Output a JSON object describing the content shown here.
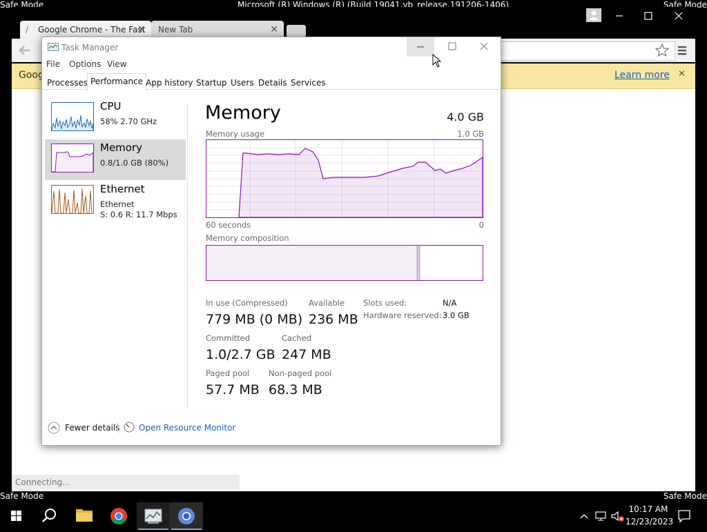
{
  "desktop": {
    "safe_mode": "Safe Mode",
    "build_text": "Microsoft (R) Windows (R) (Build 19041.vb_release.191206-1406)"
  },
  "chrome": {
    "tabs": [
      {
        "label": "Google Chrome - The Fast"
      },
      {
        "label": "New Tab"
      }
    ],
    "infobar": {
      "text": "Goog",
      "learn_more": "Learn more"
    },
    "status": "Connecting..."
  },
  "task_manager": {
    "title": "Task Manager",
    "menu": [
      "File",
      "Options",
      "View"
    ],
    "tabs": [
      "Processes",
      "Performance",
      "App history",
      "Startup",
      "Users",
      "Details",
      "Services"
    ],
    "active_tab": "Performance",
    "sidebar": [
      {
        "name": "CPU",
        "line1": "58%  2.70 GHz",
        "line2": ""
      },
      {
        "name": "Memory",
        "line1": "0.8/1.0 GB (80%)",
        "line2": ""
      },
      {
        "name": "Ethernet",
        "line1": "Ethernet",
        "line2": "S: 0.6  R: 11.7 Mbps"
      }
    ],
    "detail": {
      "heading": "Memory",
      "total": "4.0 GB",
      "usage_label": "Memory usage",
      "usage_max": "1.0 GB",
      "axis_left": "60 seconds",
      "axis_right": "0",
      "composition_label": "Memory composition",
      "stats": {
        "in_use_label": "In use (Compressed)",
        "in_use_value": "779 MB (0 MB)",
        "available_label": "Available",
        "available_value": "236 MB",
        "committed_label": "Committed",
        "committed_value": "1.0/2.7 GB",
        "cached_label": "Cached",
        "cached_value": "247 MB",
        "paged_label": "Paged pool",
        "paged_value": "57.7 MB",
        "nonpaged_label": "Non-paged pool",
        "nonpaged_value": "68.3 MB",
        "slots_label": "Slots used:",
        "slots_value": "N/A",
        "hw_label": "Hardware reserved:",
        "hw_value": "3.0 GB"
      }
    },
    "footer": {
      "fewer_details": "Fewer details",
      "open_resource_monitor": "Open Resource Monitor"
    }
  },
  "taskbar": {
    "time": "10:17 AM",
    "date": "12/23/2023"
  },
  "colors": {
    "memory_accent": "#8b12ae",
    "link": "#1a5fb4",
    "infobar": "#f9e7a1"
  }
}
